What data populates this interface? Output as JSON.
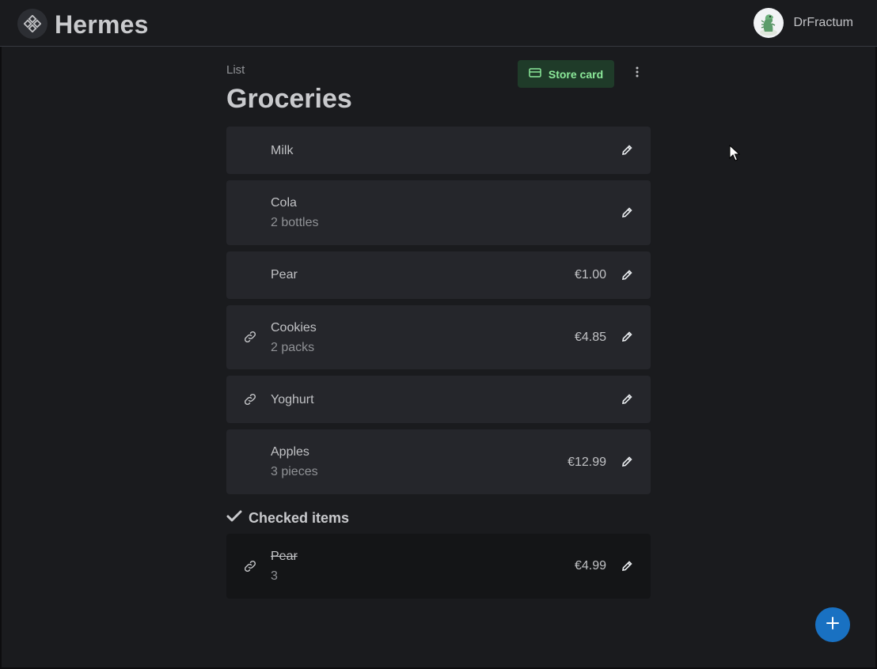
{
  "header": {
    "app_title": "Hermes",
    "username": "DrFractum",
    "logo_icon": "grid-diamond-icon",
    "avatar_icon": "dinosaur-avatar"
  },
  "list": {
    "label": "List",
    "title": "Groceries",
    "store_card_label": "Store card",
    "menu_icon": "dots-vertical-icon"
  },
  "items": [
    {
      "name": "Milk",
      "quantity": "",
      "price": "",
      "linked": false
    },
    {
      "name": "Cola",
      "quantity": "2 bottles",
      "price": "",
      "linked": false
    },
    {
      "name": "Pear",
      "quantity": "",
      "price": "€1.00",
      "linked": false
    },
    {
      "name": "Cookies",
      "quantity": "2 packs",
      "price": "€4.85",
      "linked": true
    },
    {
      "name": "Yoghurt",
      "quantity": "",
      "price": "",
      "linked": true
    },
    {
      "name": "Apples",
      "quantity": "3 pieces",
      "price": "€12.99",
      "linked": false
    }
  ],
  "checked": {
    "heading": "Checked items",
    "items": [
      {
        "name": "Pear",
        "quantity": "3",
        "price": "€4.99",
        "linked": true
      }
    ]
  },
  "colors": {
    "background": "#1a1b1e",
    "card": "#25262b",
    "accent_green_bg": "#1f3b29",
    "accent_green_text": "#8ce99a",
    "fab_blue": "#1971c2"
  }
}
